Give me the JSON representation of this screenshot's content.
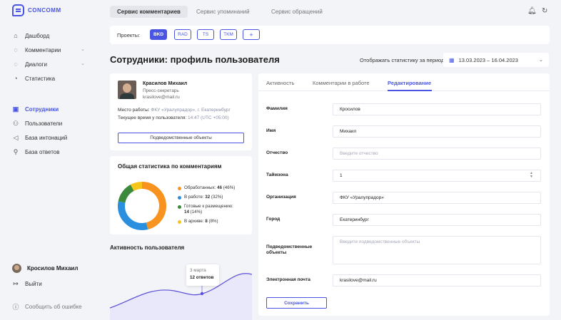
{
  "app": {
    "logo_text": "CONCOMM"
  },
  "sidebar": {
    "items": [
      {
        "label": "Дашборд",
        "icon": "home-icon"
      },
      {
        "label": "Комментарии",
        "icon": "comment-icon",
        "chevron": true
      },
      {
        "label": "Диалоги",
        "icon": "dialog-icon",
        "chevron": true
      },
      {
        "label": "Статистика",
        "icon": "stats-icon"
      },
      {
        "label": "Сотрудники",
        "icon": "briefcase-icon",
        "active": true
      },
      {
        "label": "Пользователи",
        "icon": "users-icon"
      },
      {
        "label": "База интонаций",
        "icon": "megaphone-icon"
      },
      {
        "label": "База ответов",
        "icon": "search-icon"
      }
    ],
    "user_name": "Кросилов Михаил",
    "logout_label": "Выйти",
    "report_label": "Сообщить об ошибке"
  },
  "topbar": {
    "tabs": [
      {
        "label": "Сервис комментариев",
        "active": true
      },
      {
        "label": "Сервис упоминаний",
        "active": false
      },
      {
        "label": "Сервис обращений",
        "active": false
      }
    ]
  },
  "projects": {
    "label": "Проекты:",
    "chips": [
      "BKD",
      "RAD",
      "TS",
      "TKM",
      "+"
    ],
    "active": "BKD"
  },
  "page": {
    "title": "Сотрудники: профиль пользователя",
    "period_label": "Отображать статистику за период:",
    "period_value": "13.03.2023 – 16.04.2023"
  },
  "profile": {
    "name": "Красилов Михаил",
    "role": "Пресс-секретарь",
    "email": "krasilove@mail.ru",
    "workplace_label": "Место работы:",
    "workplace_value": "ФКУ «Уралупрадор», г. Екатеринбург",
    "time_label": "Текущее время у пользователя:",
    "time_value": "14:47 (UTC +05:00)",
    "objects_button": "Подведомственные объекты"
  },
  "stats": {
    "title": "Общая статистика по комментариям",
    "legend": [
      {
        "label": "Обработанных:",
        "value": "46",
        "pct": "(46%)",
        "color": "#f7931e",
        "share": 46
      },
      {
        "label": "В работе:",
        "value": "32",
        "pct": "(32%)",
        "color": "#2b8fe0",
        "share": 32
      },
      {
        "label": "Готовые к размещению:",
        "value": "14",
        "pct": "(14%)",
        "color": "#3a8a3a",
        "share": 14
      },
      {
        "label": "В архиве:",
        "value": "8",
        "pct": "(8%)",
        "color": "#f5c518",
        "share": 8
      }
    ]
  },
  "activity": {
    "title": "Активность пользователя",
    "tooltip_date": "3 марта",
    "tooltip_count": "12 ответов"
  },
  "form": {
    "tabs": [
      {
        "label": "Активность",
        "active": false
      },
      {
        "label": "Комментарии в работе",
        "active": false
      },
      {
        "label": "Редактирование",
        "active": true
      }
    ],
    "fields": [
      {
        "label": "Фамилия",
        "value": "Кросилов",
        "placeholder": ""
      },
      {
        "label": "Имя",
        "value": "Михаил",
        "placeholder": ""
      },
      {
        "label": "Отчество",
        "value": "",
        "placeholder": "Введите отчество"
      },
      {
        "label": "Таймзона",
        "value": "1",
        "placeholder": ""
      },
      {
        "label": "Организация",
        "value": "ФКУ «Уралупрадор»",
        "placeholder": ""
      },
      {
        "label": "Город",
        "value": "Екатеринбург",
        "placeholder": ""
      },
      {
        "label": "Подведомственные объекты",
        "value": "",
        "placeholder": "Введите подведомственные объекты"
      },
      {
        "label": "Электронная почта",
        "value": "krasilove@mail.ru",
        "placeholder": ""
      }
    ],
    "save_label": "Сохранить"
  }
}
